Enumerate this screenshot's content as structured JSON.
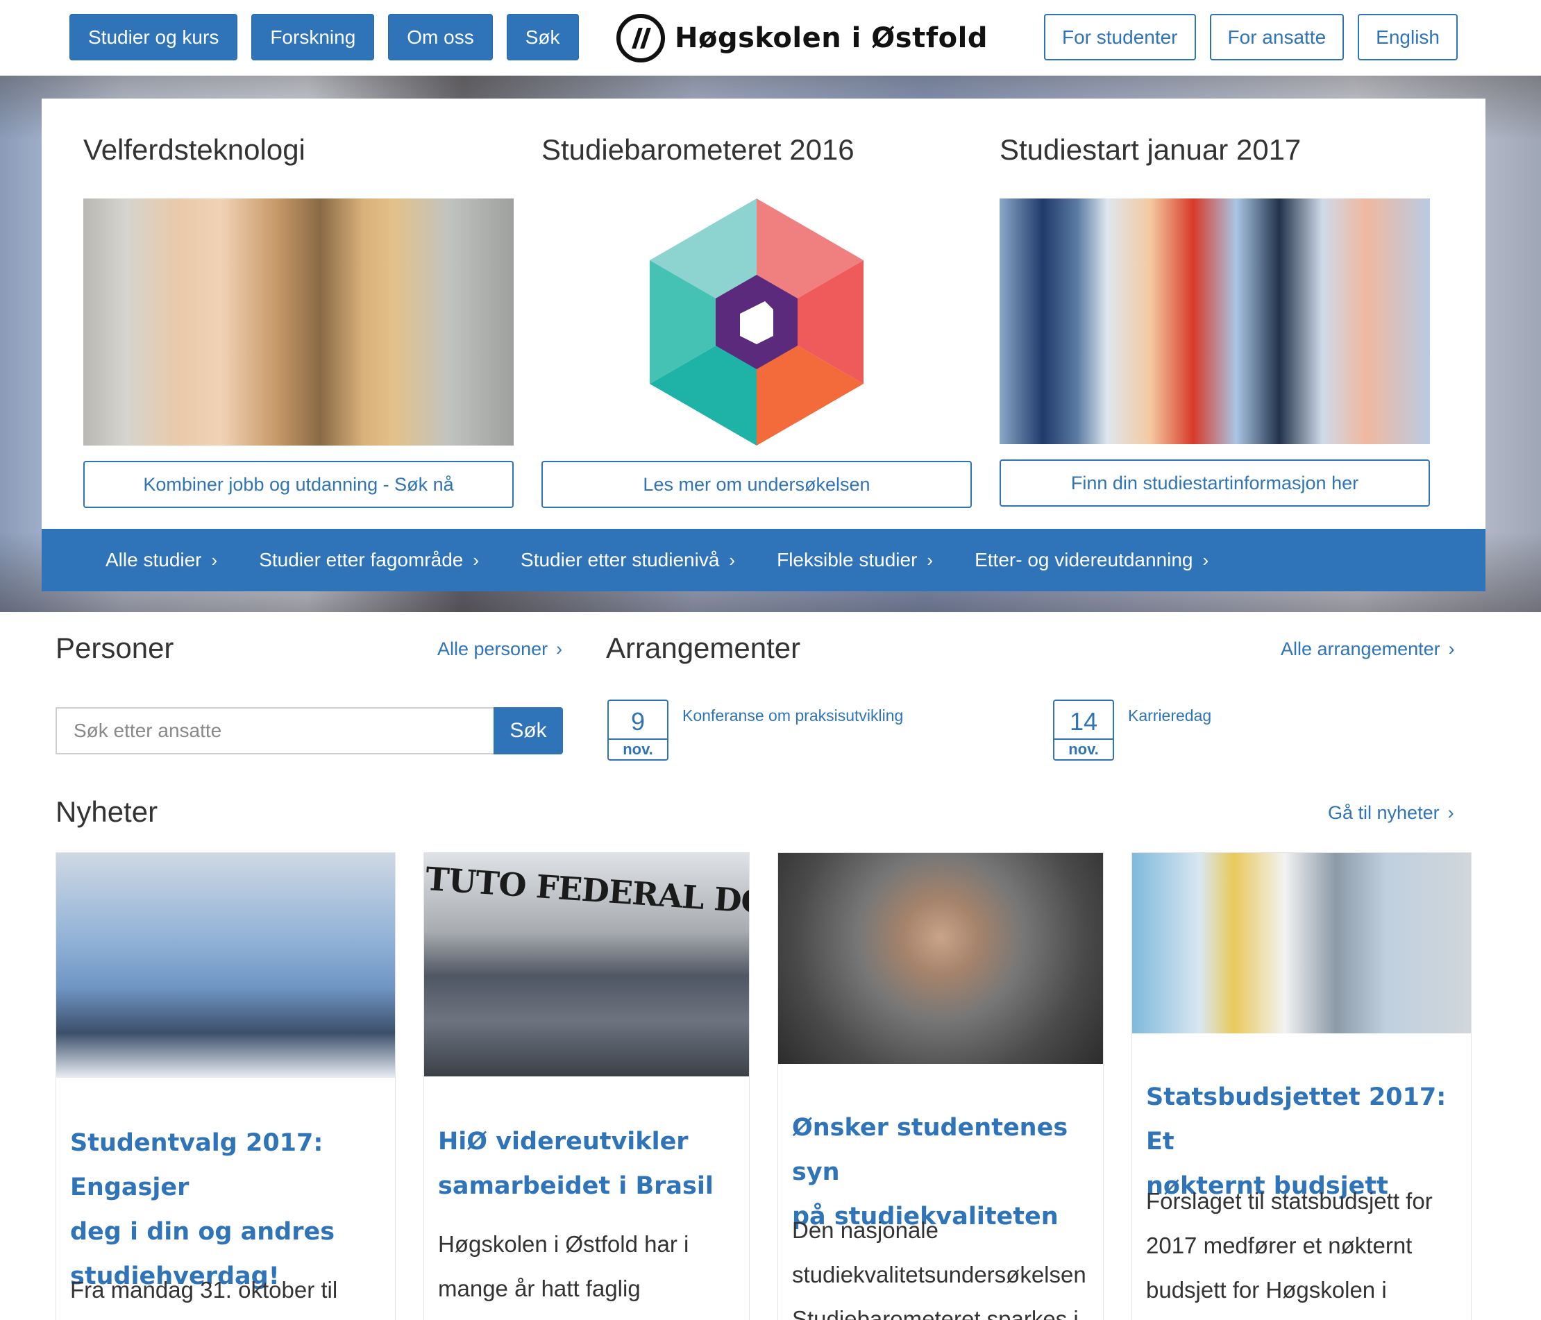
{
  "header": {
    "nav_left": [
      "Studier og kurs",
      "Forskning",
      "Om oss",
      "Søk"
    ],
    "logo_text": "Høgskolen i Østfold",
    "nav_right": [
      "For studenter",
      "For ansatte",
      "English"
    ]
  },
  "hero": {
    "features": [
      {
        "title": "Velferdsteknologi",
        "button": "Kombiner jobb og utdanning - Søk nå"
      },
      {
        "title": "Studiebarometeret 2016",
        "button": "Les mer om undersøkelsen"
      },
      {
        "title": "Studiestart januar 2017",
        "button": "Finn din studiestartinformasjon her"
      }
    ],
    "categories": [
      "Alle studier",
      "Studier etter fagområde",
      "Studier etter studienivå",
      "Fleksible studier",
      "Etter- og videreutdanning"
    ]
  },
  "personer": {
    "title": "Personer",
    "link": "Alle personer",
    "search_placeholder": "Søk etter ansatte",
    "search_button": "Søk"
  },
  "arrangementer": {
    "title": "Arrangementer",
    "link": "Alle arrangementer",
    "events": [
      {
        "day": "9",
        "month": "nov.",
        "title": "Konferanse om praksisutvikling"
      },
      {
        "day": "14",
        "month": "nov.",
        "title": "Karrieredag"
      }
    ]
  },
  "nyheter": {
    "title": "Nyheter",
    "link": "Gå til nyheter",
    "items": [
      {
        "title_lines": [
          "Studentvalg 2017: Engasjer",
          "deg i din og andres",
          "studiehverdag!"
        ],
        "text_lines": [
          "Fra mandag 31. oktober til"
        ]
      },
      {
        "title_lines": [
          "HiØ videreutvikler",
          "samarbeidet i Brasil"
        ],
        "text_lines": [
          "Høgskolen i Østfold har i",
          "mange år hatt faglig"
        ],
        "image_caption": "TUTO FEDERAL DO ESPÍRITO SANTO"
      },
      {
        "title_lines": [
          "Ønsker studentenes syn",
          "på studiekvaliteten"
        ],
        "text_lines": [
          "Den nasjonale",
          "studiekvalitetsundersøkelsen",
          "Studiebarometeret sparkes i"
        ]
      },
      {
        "title_lines": [
          "Statsbudsjettet 2017: Et",
          "nøkternt budsjett"
        ],
        "text_lines": [
          "Forslaget til statsbudsjett for",
          "2017 medfører et nøkternt",
          "budsjett for Høgskolen i"
        ]
      }
    ]
  },
  "icons": {
    "chevron": "chevron-right-icon",
    "logo": "hiof-logo-icon"
  },
  "colors": {
    "primary": "#2f74b8"
  }
}
